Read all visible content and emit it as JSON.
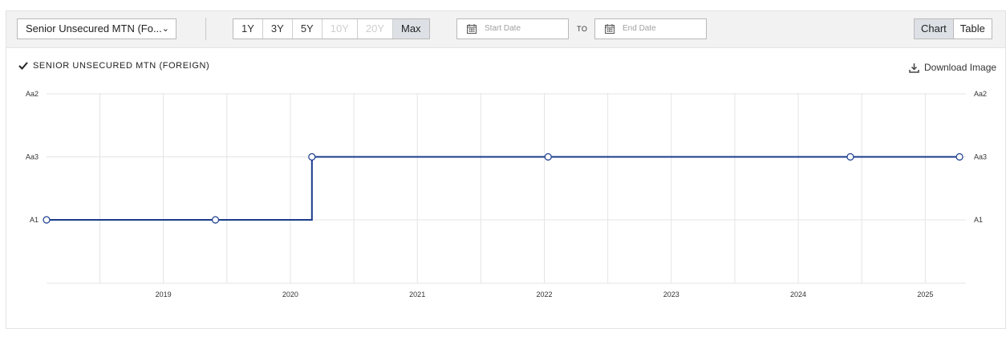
{
  "toolbar": {
    "dropdown_value": "Senior Unsecured MTN (Fo...",
    "ranges": [
      {
        "label": "1Y",
        "state": "enabled"
      },
      {
        "label": "3Y",
        "state": "enabled"
      },
      {
        "label": "5Y",
        "state": "enabled"
      },
      {
        "label": "10Y",
        "state": "disabled"
      },
      {
        "label": "20Y",
        "state": "disabled"
      },
      {
        "label": "Max",
        "state": "active"
      }
    ],
    "start_date_placeholder": "Start Date",
    "to_label": "TO",
    "end_date_placeholder": "End Date",
    "view_chart": "Chart",
    "view_table": "Table"
  },
  "legend_label": "SENIOR UNSECURED MTN (FOREIGN)",
  "download_label": "Download Image",
  "chart_data": {
    "type": "line",
    "step": true,
    "y_categories": [
      "A1",
      "Aa3",
      "Aa2"
    ],
    "x_ticks": [
      "2019",
      "2020",
      "2021",
      "2022",
      "2023",
      "2024",
      "2025"
    ],
    "xlim": [
      2018.08,
      2025.32
    ],
    "grid": true,
    "series": [
      {
        "name": "SENIOR UNSECURED MTN (FOREIGN)",
        "color": "#1a3c8c",
        "points": [
          {
            "x": 2018.0,
            "y": "A1"
          },
          {
            "x": 2019.41,
            "y": "A1"
          },
          {
            "x": 2020.17,
            "y": "Aa3"
          },
          {
            "x": 2022.03,
            "y": "Aa3"
          },
          {
            "x": 2024.41,
            "y": "Aa3"
          },
          {
            "x": 2025.27,
            "y": "Aa3"
          }
        ]
      }
    ]
  }
}
